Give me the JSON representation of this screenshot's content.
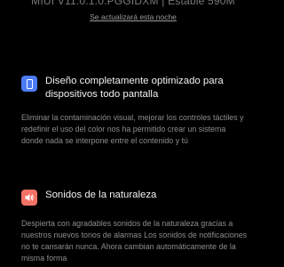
{
  "header": {
    "version": "MIUI V11.0.1.0.PGGIDXM | Estable 590M",
    "auto_update_link": "Se actualizará esta noche"
  },
  "features": [
    {
      "icon": "fullscreen-phone-icon",
      "icon_color": "#4b7cf5",
      "title": "Diseño completamente optimizado para dispositivos todo pantalla",
      "description": "Eliminar la contaminación visual, mejorar los controles táctiles y redefinir el uso del color nos ha permitido crear un sistema donde nada se interpone entre el contenido y tú"
    },
    {
      "icon": "speaker-sound-icon",
      "icon_color": "#f27266",
      "title": "Sonidos de la naturaleza",
      "description": "Despierta con agradables sonidos de la naturaleza gracias a nuestros nuevos tonos de alarmas Los sonidos de notificaciones no te cansarán nunca. Ahora cambian automáticamente de la misma forma"
    }
  ]
}
